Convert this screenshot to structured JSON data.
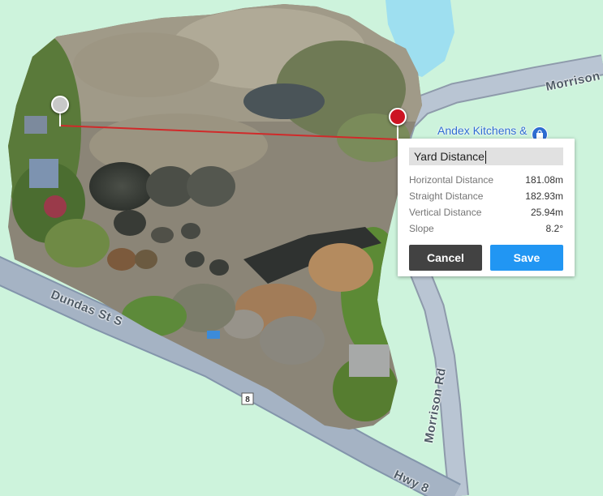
{
  "map": {
    "roads": {
      "morrison_top": "Morrison",
      "morrison_rd": "Morrison Rd",
      "dundas": "Dundas St S",
      "hwy8": "Hwy 8",
      "route_shield": "8"
    },
    "poi": {
      "name": "Andex Kitchens &",
      "icon": "shopping-bag-icon"
    },
    "colors": {
      "background": "#cdf3dc",
      "water": "#9edff0",
      "road": "#a5b3c4",
      "measure_line": "#d02a2a",
      "start_marker": "#c8c8c8",
      "end_marker": "#cc1423"
    }
  },
  "measurement_panel": {
    "name_value": "Yard Distance",
    "rows": [
      {
        "label": "Horizontal Distance",
        "value": "181.08m"
      },
      {
        "label": "Straight Distance",
        "value": "182.93m"
      },
      {
        "label": "Vertical Distance",
        "value": "25.94m"
      },
      {
        "label": "Slope",
        "value": "8.2°"
      }
    ],
    "cancel_label": "Cancel",
    "save_label": "Save",
    "colors": {
      "cancel": "#424242",
      "save": "#2196f3"
    }
  }
}
